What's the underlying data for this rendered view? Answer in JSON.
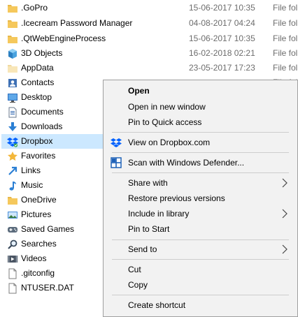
{
  "files": [
    {
      "name": ".GoPro",
      "date": "15-06-2017 10:35",
      "type": "File fol",
      "icon": "folder-icon"
    },
    {
      "name": ".Icecream Password Manager",
      "date": "04-08-2017 04:24",
      "type": "File fol",
      "icon": "folder-icon"
    },
    {
      "name": ".QtWebEngineProcess",
      "date": "15-06-2017 10:35",
      "type": "File fol",
      "icon": "folder-icon"
    },
    {
      "name": "3D Objects",
      "date": "16-02-2018 02:21",
      "type": "File fol",
      "icon": "3d-objects-icon"
    },
    {
      "name": "AppData",
      "date": "23-05-2017 17:23",
      "type": "File fol",
      "icon": "folder-hidden-icon"
    },
    {
      "name": "Contacts",
      "date": "",
      "type": "File fol",
      "icon": "contacts-icon"
    },
    {
      "name": "Desktop",
      "date": "",
      "type": "",
      "icon": "desktop-icon"
    },
    {
      "name": "Documents",
      "date": "",
      "type": "",
      "icon": "documents-icon"
    },
    {
      "name": "Downloads",
      "date": "",
      "type": "",
      "icon": "downloads-icon"
    },
    {
      "name": "Dropbox",
      "date": "",
      "type": "",
      "icon": "dropbox-icon"
    },
    {
      "name": "Favorites",
      "date": "",
      "type": "",
      "icon": "favorites-icon"
    },
    {
      "name": "Links",
      "date": "",
      "type": "",
      "icon": "links-icon"
    },
    {
      "name": "Music",
      "date": "",
      "type": "",
      "icon": "music-icon"
    },
    {
      "name": "OneDrive",
      "date": "",
      "type": "",
      "icon": "folder-icon"
    },
    {
      "name": "Pictures",
      "date": "",
      "type": "",
      "icon": "pictures-icon"
    },
    {
      "name": "Saved Games",
      "date": "",
      "type": "",
      "icon": "saved-games-icon"
    },
    {
      "name": "Searches",
      "date": "",
      "type": "",
      "icon": "searches-icon"
    },
    {
      "name": "Videos",
      "date": "",
      "type": "",
      "icon": "videos-icon"
    },
    {
      "name": ".gitconfig",
      "date": "",
      "type": "",
      "icon": "file-icon"
    },
    {
      "name": "NTUSER.DAT",
      "date": "",
      "type": "",
      "icon": "file-icon"
    }
  ],
  "selected_file": "Dropbox",
  "context_menu": {
    "open": "Open",
    "open_new_window": "Open in new window",
    "pin_quick_access": "Pin to Quick access",
    "view_dropbox": "View on Dropbox.com",
    "scan_defender": "Scan with Windows Defender...",
    "share_with": "Share with",
    "restore_versions": "Restore previous versions",
    "include_library": "Include in library",
    "pin_start": "Pin to Start",
    "send_to": "Send to",
    "cut": "Cut",
    "copy": "Copy",
    "create_shortcut": "Create shortcut"
  },
  "colors": {
    "folder": "#e8b84a",
    "selection": "#cce8ff",
    "menu_bg": "#f2f2f2",
    "dropbox_blue": "#0061fe",
    "defender_blue": "#1f62b8"
  }
}
